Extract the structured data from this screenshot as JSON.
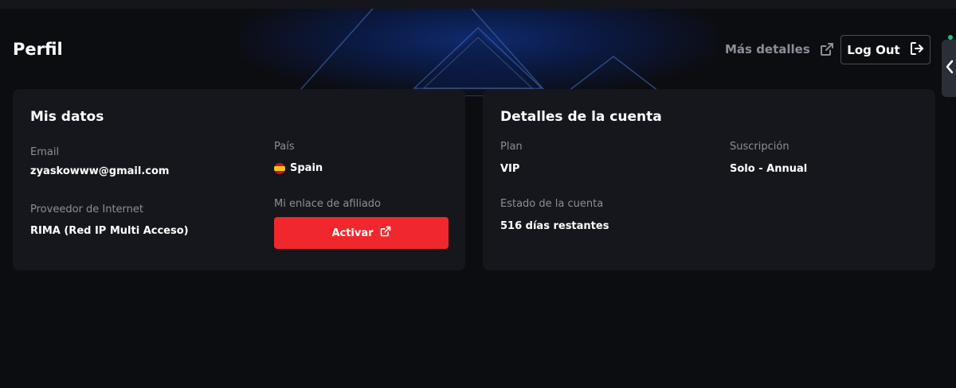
{
  "header": {
    "title": "Perfil",
    "details_link": "Más detalles",
    "logout_label": "Log Out"
  },
  "my_data": {
    "title": "Mis datos",
    "email_label": "Email",
    "email_value": "zyaskowww@gmail.com",
    "isp_label": "Proveedor de Internet",
    "isp_value": "RIMA (Red IP Multi Acceso)",
    "country_label": "País",
    "country_value": "Spain",
    "affiliate_label": "Mi enlace de afiliado",
    "activate_label": "Activar"
  },
  "account": {
    "title": "Detalles de la cuenta",
    "plan_label": "Plan",
    "plan_value": "VIP",
    "subscription_label": "Suscripción",
    "subscription_value": "Solo - Annual",
    "status_label": "Estado de la cuenta",
    "status_value": "516 días restantes"
  },
  "icons": {
    "external_link": "external-link-icon",
    "logout": "logout-icon",
    "flag": "spain-flag-icon",
    "side_toggle": "chevron-left-icon",
    "status": "online-status-dot"
  },
  "colors": {
    "background": "#0c0d11",
    "card": "#15171c",
    "accent_red": "#f0282d",
    "muted_text": "#8b8f99",
    "status_green": "#1fbf7a"
  }
}
